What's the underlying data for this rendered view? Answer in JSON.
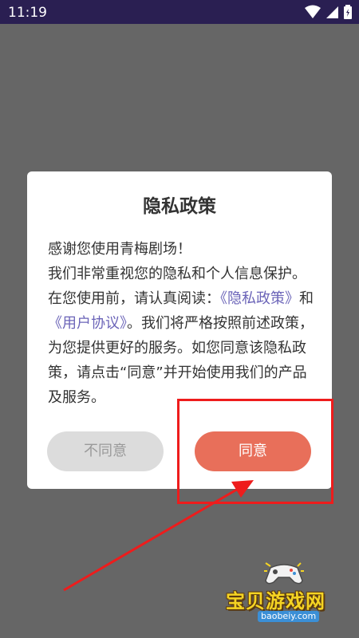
{
  "status_bar": {
    "time": "11:19",
    "icons": [
      "wifi-icon",
      "signal-icon",
      "battery-icon"
    ]
  },
  "dialog": {
    "title": "隐私政策",
    "line1": "感谢您使用青梅剧场！",
    "line2_prefix": "我们非常重视您的隐私和个人信息保护。在您使用前，请认真阅读：",
    "privacy_link": "《隐私政策》",
    "connector": "和",
    "agreement_link": "《用户协议》",
    "line2_suffix": "。我们将严格按照前述政策，为您提供更好的服务。如您同意该隐私政策，请点击“同意”并开始使用我们的产品及服务。",
    "disagree_label": "不同意",
    "agree_label": "同意"
  },
  "colors": {
    "status_bar": "#2a1f52",
    "overlay": "#666666",
    "link": "#6b64b8",
    "agree_button": "#e86f5a",
    "disagree_button": "#dcdcdc",
    "annotation": "#ee1c1c"
  },
  "watermark": {
    "text": "宝贝游戏网",
    "url": "baobeiy.com"
  }
}
